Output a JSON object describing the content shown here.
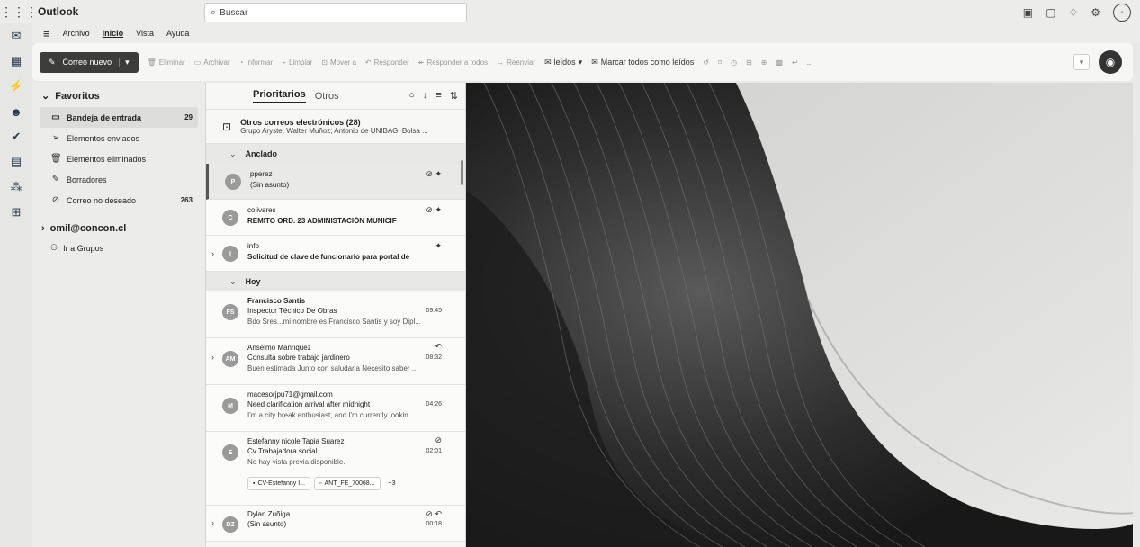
{
  "titlebar": {
    "app_title": "Outlook",
    "search_placeholder": "Buscar",
    "search_icon": "search-icon",
    "icons": [
      "store-icon",
      "feedback-icon",
      "bell-icon",
      "settings-icon",
      "account-icon"
    ]
  },
  "rail": {
    "icons": [
      "mail-icon",
      "calendar-icon",
      "bolt-icon",
      "people-icon",
      "todo-icon",
      "files-icon",
      "apps-icon",
      "more-apps-icon"
    ]
  },
  "menu": {
    "items": [
      "Archivo",
      "Inicio",
      "Vista",
      "Ayuda"
    ],
    "active": "Inicio"
  },
  "ribbon": {
    "new_mail": "Correo nuevo",
    "delete": "Eliminar",
    "archive": "Archivar",
    "report": "Informar",
    "sweep": "Limpiar",
    "move": "Mover a",
    "reply": "Responder",
    "reply_all": "Responder a todos",
    "forward": "Reenviar",
    "read": "leídos",
    "mark_all_read": "Marcar todos como leídos",
    "more": "..."
  },
  "folders": {
    "favorites_label": "Favoritos",
    "items": [
      {
        "label": "Bandeja de entrada",
        "count": "29",
        "icon": "inbox-icon"
      },
      {
        "label": "Elementos enviados",
        "count": "",
        "icon": "send-icon"
      },
      {
        "label": "Elementos eliminados",
        "count": "",
        "icon": "trash-icon"
      },
      {
        "label": "Borradores",
        "count": "",
        "icon": "pencil-icon"
      },
      {
        "label": "Correo no deseado",
        "count": "263",
        "icon": "junk-icon"
      }
    ],
    "account": "omil@concon.cl",
    "groups_link": "Ir a Grupos"
  },
  "list": {
    "tab_focused": "Prioritarios",
    "tab_other": "Otros",
    "others_banner": {
      "title": "Otros correos electrónicos (28)",
      "preview": "Grupo Aryste; Walter Muñoz; Antonio de UNIBAG; Bolsa ..."
    },
    "section_pinned": "Anclado",
    "section_today": "Hoy",
    "pinned": [
      {
        "avatar": "P",
        "sender": "pperez",
        "subject": "(Sin asunto)"
      },
      {
        "avatar": "C",
        "sender": "colivares",
        "subject": "REMITO ORD. 23 ADMINISTACIÓN MUNICIF"
      },
      {
        "avatar": "I",
        "sender": "info",
        "subject": "Solicitud de clave de funcionario para portal de"
      }
    ],
    "today": [
      {
        "avatar": "FS",
        "sender": "Francisco Santis",
        "subject": "Inspector Técnico De Obras",
        "time": "09:45",
        "preview": "Bdo Sres...mi nombre es Francisco Santis y soy Dipl..."
      },
      {
        "avatar": "AM",
        "sender": "Anselmo Manriquez",
        "subject": "Consulta sobre trabajo jardinero",
        "time": "08:32",
        "preview": "Buen estimada Junto con saludarla Necesito saber ..."
      },
      {
        "avatar": "M",
        "sender": "macesorjpu71@gmail.com",
        "subject": "Need clarification arrival after midnight",
        "time": "04:26",
        "preview": "I'm a city break enthusiast, and I'm currently lookin..."
      },
      {
        "avatar": "E",
        "sender": "Estefanny nicole Tapia Suarez",
        "subject": "Cv Trabajadora social",
        "time": "02:01",
        "preview": "No hay vista previa disponible.",
        "attachments": [
          "CV-Estefanny I...",
          "ANT_FE_70068...",
          "+3"
        ]
      },
      {
        "avatar": "DZ",
        "sender": "Dylan Zuñiga",
        "subject": "(Sin asunto)",
        "time": "00:18",
        "preview": ""
      }
    ]
  }
}
